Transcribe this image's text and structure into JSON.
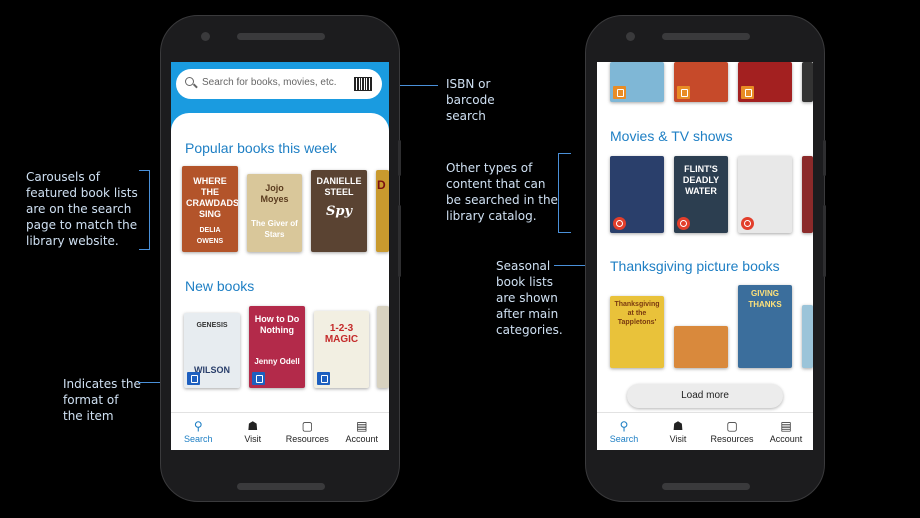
{
  "annotations": {
    "isbn": "ISBN or\nbarcode\nsearch",
    "carousels": "Carousels of\nfeatured book lists\nare on the search\npage to match the\nlibrary website.",
    "format": "Indicates the\nformat of\nthe item",
    "other_content": "Other types of\ncontent that can\nbe searched in the\nlibrary catalog.",
    "seasonal": "Seasonal\nbook lists\nare shown\nafter main\ncategories."
  },
  "left_phone": {
    "search_placeholder": "Search for books, movies, etc.",
    "rows": [
      {
        "title": "Popular books this week",
        "books": [
          {
            "text": "WHERE THE CRAWDADS SING",
            "author": "DELIA OWENS",
            "color": "#b3542a"
          },
          {
            "text": "Jojo Moyes",
            "author": "The Giver of Stars",
            "color": "#d9c79a"
          },
          {
            "text": "DANIELLE STEEL",
            "author": "Spy",
            "color": "#5a4332"
          },
          {
            "text": "D",
            "author": "",
            "color": "#c99a2e"
          }
        ]
      },
      {
        "title": "New books",
        "books": [
          {
            "text": "GENESIS",
            "author": "WILSON",
            "color": "#e7ecf0"
          },
          {
            "text": "How to Do Nothing",
            "author": "Jenny Odell",
            "color": "#b32a4a"
          },
          {
            "text": "1-2-3 MAGIC",
            "author": "",
            "color": "#f2efe2"
          },
          {
            "text": "",
            "author": "",
            "color": "#d8d2c0"
          }
        ]
      }
    ],
    "nav": [
      {
        "label": "Search",
        "icon": "search-icon"
      },
      {
        "label": "Visit",
        "icon": "building-icon"
      },
      {
        "label": "Resources",
        "icon": "devices-icon"
      },
      {
        "label": "Account",
        "icon": "card-icon"
      }
    ]
  },
  "right_phone": {
    "rows": [
      {
        "title": "Movies & TV shows",
        "items": [
          {
            "text": "",
            "color": "#2a3f6b"
          },
          {
            "text": "FLINT'S DEADLY WATER",
            "color": "#2c3e50"
          },
          {
            "text": "",
            "color": "#e8e8e8"
          },
          {
            "text": "",
            "color": "#8b2a2a"
          }
        ]
      },
      {
        "title": "Thanksgiving picture books",
        "items": [
          {
            "text": "Thanksgiving at the Tappletons'",
            "color": "#e9c23a"
          },
          {
            "text": "",
            "color": "#d9893c"
          },
          {
            "text": "GIVING THANKS",
            "color": "#3b6e9c"
          },
          {
            "text": "",
            "color": "#9bc4d9"
          }
        ]
      }
    ],
    "top_items": [
      {
        "color": "#7fb7d6"
      },
      {
        "color": "#c64a2a"
      },
      {
        "color": "#a32020"
      }
    ],
    "load_more": "Load more",
    "nav": [
      {
        "label": "Search",
        "icon": "search-icon"
      },
      {
        "label": "Visit",
        "icon": "building-icon"
      },
      {
        "label": "Resources",
        "icon": "devices-icon"
      },
      {
        "label": "Account",
        "icon": "card-icon"
      }
    ]
  }
}
